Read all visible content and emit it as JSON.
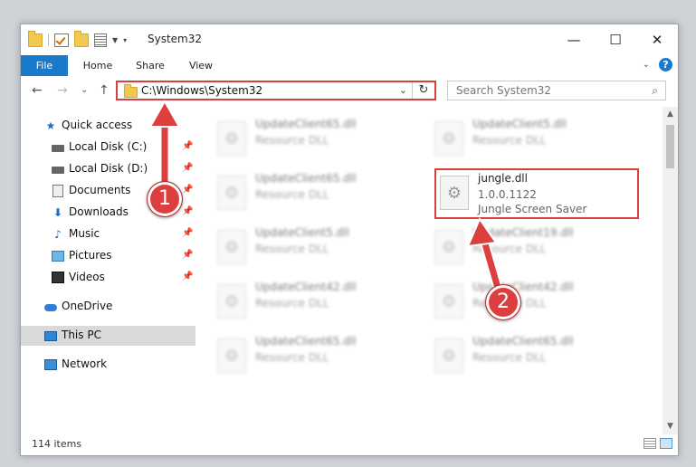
{
  "window": {
    "title": "System32",
    "minimize": "—",
    "maximize": "☐",
    "close": "✕"
  },
  "ribbon": {
    "tabs": [
      "File",
      "Home",
      "Share",
      "View"
    ],
    "collapse": "⌄",
    "help": "?"
  },
  "nav": {
    "back": "←",
    "forward": "→",
    "recent": "⌄",
    "up": "↑",
    "address": "C:\\Windows\\System32",
    "address_dropdown": "⌄",
    "refresh": "↻",
    "search_placeholder": "Search System32",
    "search_icon": "⌕"
  },
  "sidebar": {
    "items": [
      {
        "label": "Quick access",
        "icon": "star-icon"
      },
      {
        "label": "Local Disk (C:)",
        "icon": "disk-icon",
        "pinned": true
      },
      {
        "label": "Local Disk (D:)",
        "icon": "disk-icon",
        "pinned": true
      },
      {
        "label": "Documents",
        "icon": "documents-icon",
        "pinned": true
      },
      {
        "label": "Downloads",
        "icon": "downloads-icon",
        "pinned": true
      },
      {
        "label": "Music",
        "icon": "music-icon",
        "pinned": true
      },
      {
        "label": "Pictures",
        "icon": "pictures-icon",
        "pinned": true
      },
      {
        "label": "Videos",
        "icon": "videos-icon",
        "pinned": true
      },
      {
        "label": "OneDrive",
        "icon": "onedrive-icon"
      },
      {
        "label": "This PC",
        "icon": "this-pc-icon",
        "selected": true
      },
      {
        "label": "Network",
        "icon": "network-icon"
      }
    ],
    "pin_glyph": "📌"
  },
  "files": [
    {
      "name": "UpdateClient65.dll",
      "type": "Resource DLL"
    },
    {
      "name": "UpdateClient5.dll",
      "type": "Resource DLL"
    },
    {
      "name": "UpdateClient65.dll",
      "type": "Resource DLL"
    },
    {
      "name": "jungle.dll",
      "version": "1.0.0.1122",
      "description": "Jungle Screen Saver",
      "highlighted": true
    },
    {
      "name": "UpdateClient5.dll",
      "type": "Resource DLL"
    },
    {
      "name": "UpdateClient19.dll",
      "type": "Resource DLL"
    },
    {
      "name": "UpdateClient42.dll",
      "type": "Resource DLL"
    },
    {
      "name": "UpdateClient42.dll",
      "type": "Resource DLL"
    },
    {
      "name": "UpdateClient65.dll",
      "type": "Resource DLL"
    },
    {
      "name": "UpdateClient65.dll",
      "type": "Resource DLL"
    }
  ],
  "file_icon_glyph": "⚙",
  "status": {
    "items_count": "114 items"
  },
  "callouts": [
    "1",
    "2"
  ],
  "colors": {
    "accent": "#1979ca",
    "highlight": "#d8403f",
    "selected": "#d9d9d9"
  }
}
